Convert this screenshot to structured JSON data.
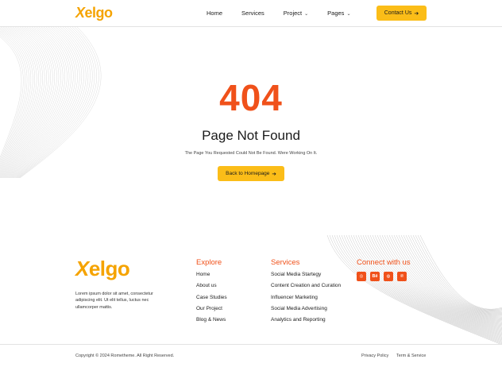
{
  "brand": {
    "logo_first": "X",
    "logo_rest": "elgo",
    "accent": "#f0511a",
    "button": "#fbbd18"
  },
  "nav": {
    "items": [
      "Home",
      "Services"
    ],
    "project": "Project",
    "pages": "Pages",
    "caret_icon": "chevron-down-icon"
  },
  "contact": {
    "label": "Contact Us",
    "icon": "arrow-right-icon",
    "arrow": "➔"
  },
  "error": {
    "code": "404",
    "title": "Page Not Found",
    "message": "The Page You Requested Could Not Be Found. Were Working On It.",
    "button": "Back to Homepage"
  },
  "footer": {
    "about": "Lorem ipsum dolor sit amet, consectetur adipiscing elit. Ut elit tellus, luctus nec ullamcorper mattis.",
    "explore": {
      "title": "Explore",
      "links": [
        "Home",
        "About us",
        "Case Studies",
        "Our Project",
        "Blog & News"
      ]
    },
    "services": {
      "title": "Services",
      "links": [
        "Social Media Startegy",
        "Content Creation and Curation",
        "Influencer Marketing",
        "Social Media Advertising",
        "Analytics and Reporting"
      ]
    },
    "connect": {
      "title": "Connect with us",
      "socials": [
        {
          "icon": "instagram-icon",
          "glyph": "◎"
        },
        {
          "icon": "behance-icon",
          "glyph": "Bē"
        },
        {
          "icon": "dribbble-icon",
          "glyph": "◍"
        },
        {
          "icon": "pinterest-icon",
          "glyph": "℗"
        }
      ]
    },
    "copyright": "Copyright © 2024 Rometheme. All Right Reserved.",
    "privacy": "Privacy Policy",
    "terms": "Term & Service"
  }
}
